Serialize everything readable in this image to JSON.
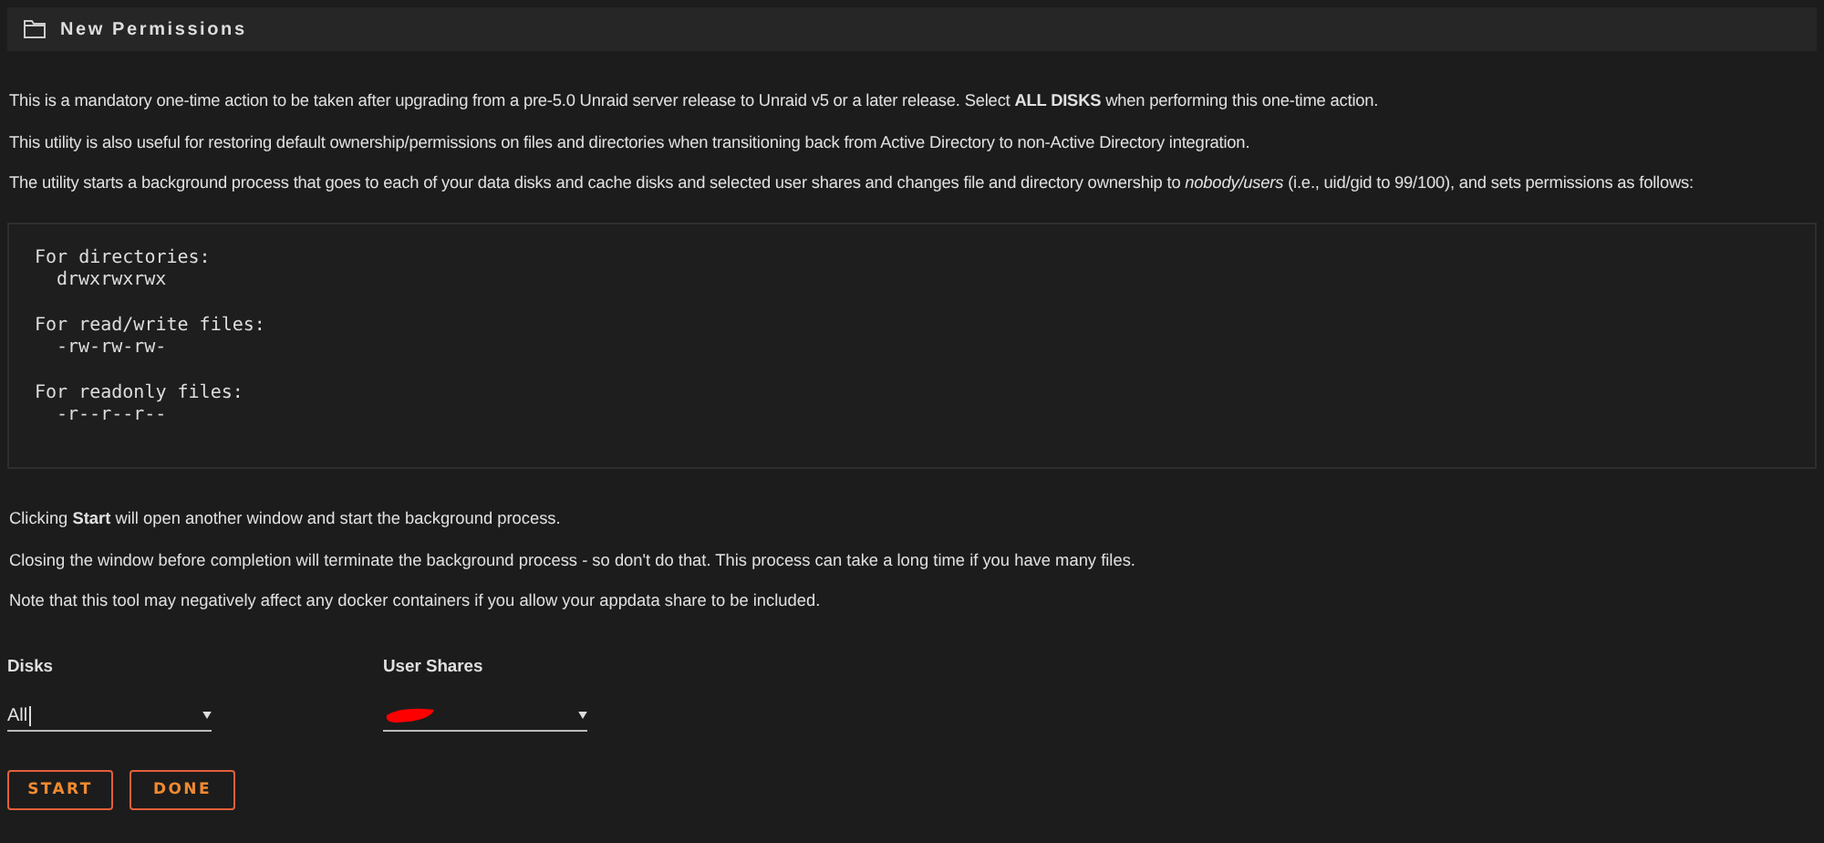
{
  "header": {
    "title": "New Permissions"
  },
  "intro": [
    "This is a mandatory one-time action to be taken after upgrading from a pre-5.0 Unraid server release to Unraid v5 or a later release. Select **ALL DISKS** when performing this one-time action.",
    "This utility is also useful for restoring default ownership/permissions on files and directories when transitioning back from Active Directory to non-Active Directory integration.",
    "The utility starts a background process that goes to each of your data disks and cache disks and selected user shares and changes file and directory ownership to *nobody/users* (i.e., uid/gid to 99/100), and sets permissions as follows:"
  ],
  "permissions": [
    {
      "label": "For directories:",
      "mode": "drwxrwxrwx"
    },
    {
      "label": "For read/write files:",
      "mode": "-rw-rw-rw-"
    },
    {
      "label": "For readonly files:",
      "mode": "-r--r--r--"
    }
  ],
  "notes": [
    "Clicking **Start** will open another window and start the background process.",
    "Closing the window before completion will terminate the background process - so don't do that. This process can take a long time if you have many files.",
    "Note that this tool may negatively affect any docker containers if you allow your appdata share to be included."
  ],
  "fields": [
    {
      "label": "Disks",
      "value": "All",
      "redacted": false
    },
    {
      "label": "User Shares",
      "redacted": true
    }
  ],
  "buttons": [
    "START",
    "DONE"
  ]
}
